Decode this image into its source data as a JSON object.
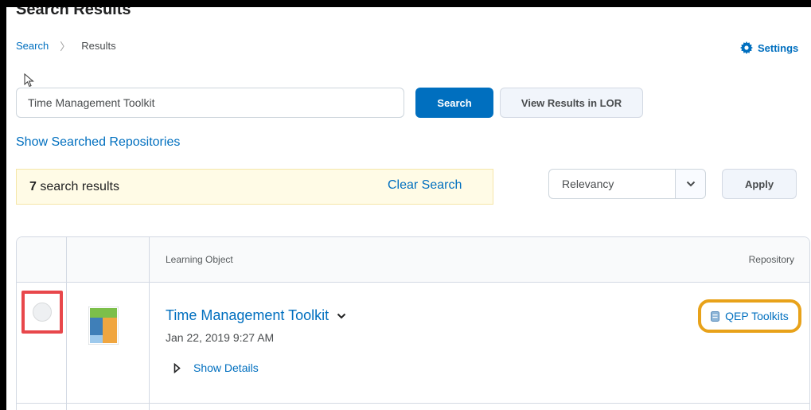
{
  "header": {
    "page_title": "Search Results",
    "breadcrumb": {
      "link": "Search",
      "current": "Results"
    },
    "settings_label": "Settings"
  },
  "search": {
    "value": "Time Management Toolkit",
    "search_button": "Search",
    "view_lor_button": "View Results in LOR"
  },
  "show_repos_link": "Show Searched Repositories",
  "results_alert": {
    "count": "7",
    "suffix": " search results",
    "clear_label": "Clear Search"
  },
  "sort": {
    "selected": "Relevancy",
    "apply_label": "Apply"
  },
  "table": {
    "headers": {
      "learning_object": "Learning Object",
      "repository": "Repository"
    },
    "rows": [
      {
        "title": "Time Management Toolkit",
        "date": "Jan 22, 2019 9:27 AM",
        "details_label": "Show Details",
        "repository": "QEP Toolkits"
      }
    ]
  },
  "colors": {
    "link": "#006fbf",
    "highlight_red": "#e8474b",
    "highlight_orange": "#e8a21a",
    "alert_bg": "#fffbe6"
  },
  "icons": [
    "gear-icon",
    "cursor-icon",
    "chevron-down-icon",
    "item-thumbnail-icon",
    "caret-right-icon",
    "repository-icon"
  ]
}
